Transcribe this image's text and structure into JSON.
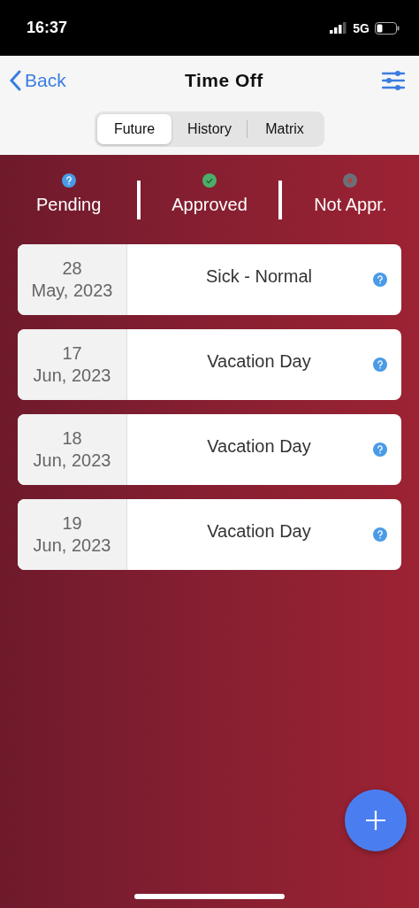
{
  "status_bar": {
    "time": "16:37",
    "network": "5G"
  },
  "nav": {
    "back": "Back",
    "title": "Time Off"
  },
  "tabs": [
    {
      "label": "Future",
      "selected": true
    },
    {
      "label": "History",
      "selected": false
    },
    {
      "label": "Matrix",
      "selected": false
    }
  ],
  "legend": [
    {
      "kind": "pending",
      "label": "Pending"
    },
    {
      "kind": "approved",
      "label": "Approved"
    },
    {
      "kind": "rejected",
      "label": "Not Appr."
    }
  ],
  "requests": [
    {
      "day": "28",
      "month": "May, 2023",
      "type": "Sick - Normal",
      "kind": "pending"
    },
    {
      "day": "17",
      "month": "Jun, 2023",
      "type": "Vacation Day",
      "kind": "pending"
    },
    {
      "day": "18",
      "month": "Jun, 2023",
      "type": "Vacation Day",
      "kind": "pending"
    },
    {
      "day": "19",
      "month": "Jun, 2023",
      "type": "Vacation Day",
      "kind": "pending"
    }
  ]
}
